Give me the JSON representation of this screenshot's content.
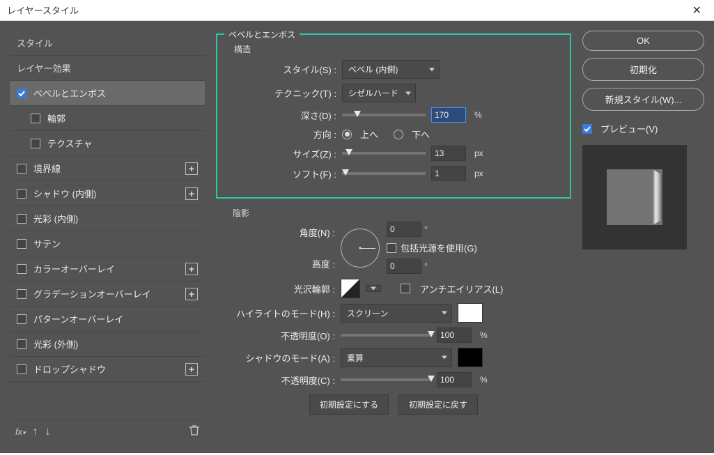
{
  "window": {
    "title": "レイヤースタイル"
  },
  "left": {
    "styles_header": "スタイル",
    "blending_options": "レイヤー効果",
    "bevel_emboss": "ベベルとエンボス",
    "contour": "輪郭",
    "texture": "テクスチャ",
    "stroke": "境界線",
    "inner_shadow": "シャドウ (内側)",
    "inner_glow": "光彩 (内側)",
    "satin": "サテン",
    "color_overlay": "カラーオーバーレイ",
    "gradient_overlay": "グラデーションオーバーレイ",
    "pattern_overlay": "パターンオーバーレイ",
    "outer_glow": "光彩 (外側)",
    "drop_shadow": "ドロップシャドウ"
  },
  "center": {
    "bevel_emboss_title": "ベベルとエンボス",
    "structure_title": "構造",
    "style_label": "スタイル(S)",
    "style_value": "ベベル (内側)",
    "technique_label": "テクニック(T)",
    "technique_value": "シゼルハード",
    "depth_label": "深さ(D)",
    "depth_value": "170",
    "direction_label": "方向",
    "direction_up": "上へ",
    "direction_down": "下へ",
    "size_label": "サイズ(Z)",
    "size_value": "13",
    "soften_label": "ソフト(F)",
    "soften_value": "1",
    "shading_title": "陰影",
    "angle_label": "角度(N)",
    "angle_value": "0",
    "global_light": "包括光源を使用(G)",
    "altitude_label": "高度",
    "altitude_value": "0",
    "gloss_contour_label": "光沢輪郭",
    "antialias": "アンチエイリアス(L)",
    "highlight_mode_label": "ハイライトのモード(H)",
    "highlight_mode_value": "スクリーン",
    "opacity_label_h": "不透明度(O)",
    "highlight_opacity": "100",
    "shadow_mode_label": "シャドウのモード(A)",
    "shadow_mode_value": "乗算",
    "opacity_label_s": "不透明度(C)",
    "shadow_opacity": "100",
    "make_default": "初期設定にする",
    "reset_default": "初期設定に戻す"
  },
  "right": {
    "ok": "OK",
    "cancel": "初期化",
    "new_style": "新規スタイル(W)...",
    "preview": "プレビュー(V)"
  },
  "units": {
    "percent": "%",
    "px": "px",
    "deg": "°"
  },
  "colors": {
    "highlight": "#ffffff",
    "shadow": "#000000",
    "highlight_border": "#2cc7a8"
  }
}
